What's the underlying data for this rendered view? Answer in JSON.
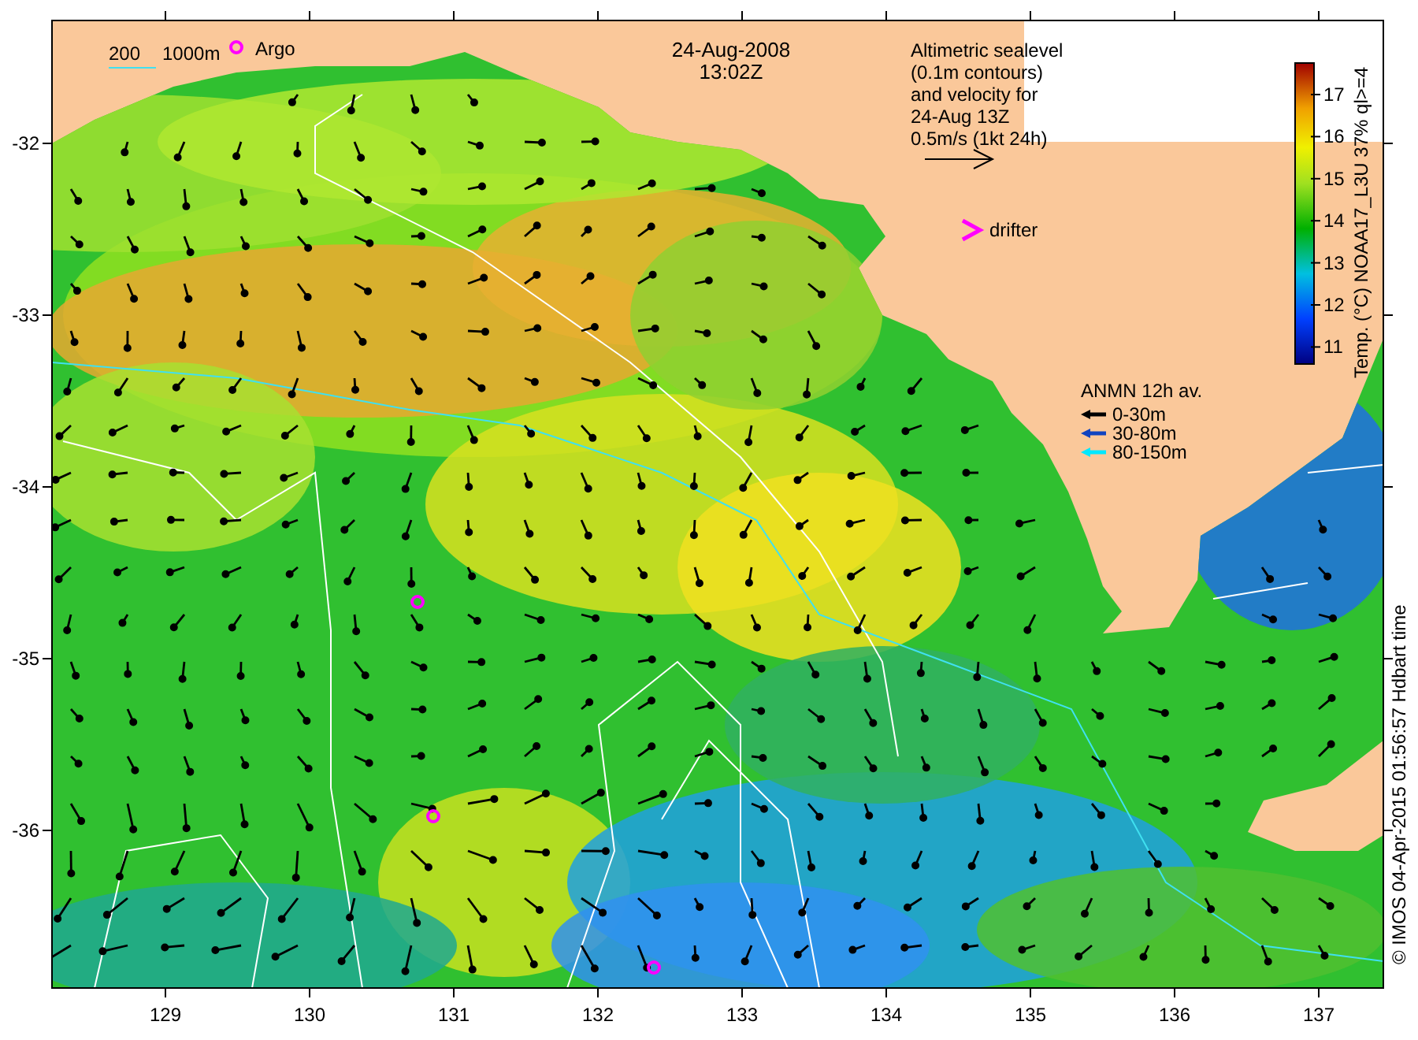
{
  "map": {
    "title_date": "24-Aug-2008",
    "title_time": "13:02Z",
    "depth_legend": {
      "shallow_label": "200",
      "deep_label": "1000m"
    },
    "argo_legend": {
      "label": "Argo"
    },
    "altimetry_note": [
      "Altimetric sealevel",
      "(0.1m contours)",
      "and velocity for",
      "24-Aug 13Z",
      "0.5m/s (1kt 24h)"
    ],
    "drifter_legend": {
      "label": "drifter"
    },
    "anmn_legend": {
      "title": "ANMN 12h av.",
      "entries": [
        {
          "label": "0-30m",
          "color": "#000000"
        },
        {
          "label": "30-80m",
          "color": "#1044c0"
        },
        {
          "label": "80-150m",
          "color": "#00e8ff"
        }
      ]
    },
    "colorbar": {
      "label": "Temp. (°C) NOAA17_L3U 37% ql>=4",
      "ticks": [
        "17",
        "16",
        "15",
        "14",
        "13",
        "12",
        "11"
      ]
    },
    "x_axis": {
      "ticks": [
        "129",
        "130",
        "131",
        "132",
        "133",
        "134",
        "135",
        "136",
        "137"
      ]
    },
    "y_axis": {
      "ticks": [
        "-32",
        "-33",
        "-34",
        "-35",
        "-36"
      ]
    },
    "credit": "© IMOS 04-Apr-2015 01:56:57 Hdbart time"
  }
}
